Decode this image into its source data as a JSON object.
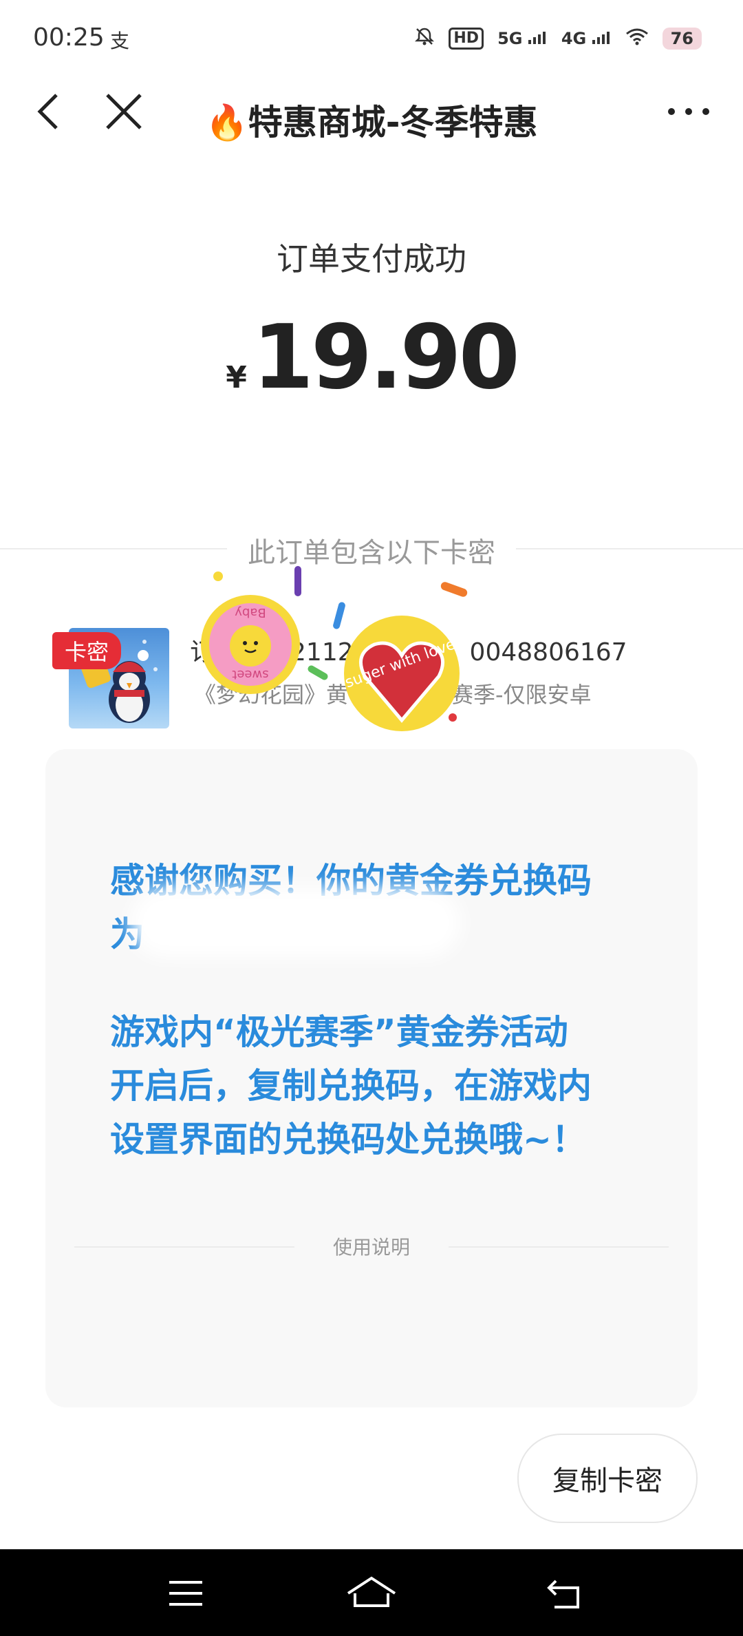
{
  "status_bar": {
    "time": "00:25",
    "app_icon": "支",
    "hd_label": "HD",
    "signal_1": "5G",
    "signal_2": "4G",
    "battery": "76"
  },
  "nav": {
    "title": "🔥特惠商城-冬季特惠",
    "back_icon": "chevron-left-icon",
    "close_icon": "close-icon",
    "more_icon": "more-icon"
  },
  "payment": {
    "status_text": "订单支付成功",
    "currency": "¥",
    "amount": "19.90"
  },
  "divider_text": "此订单包含以下卡密",
  "order": {
    "badge": "卡密",
    "number_prefix": "订",
    "number_visible_1": "21120",
    "number_visible_2": "0048806167",
    "name_1": "《梦幻花园》黄",
    "name_2": "赛季-仅限安卓"
  },
  "card": {
    "line1": "感谢您购买！你的黄金券兑换码",
    "line2": "为",
    "line3": "游戏内“极光赛季”黄金券活动",
    "line4": "开启后，复制兑换码，在游戏内",
    "line5": "设置界面的兑换码处兑换哦~！",
    "usage_label": "使用说明"
  },
  "copy_button": "复制卡密",
  "stickers": {
    "baby_top": "Baby",
    "baby_bottom": "sweet",
    "heart_text": "suger with love"
  },
  "colors": {
    "accent_blue": "#2a8bdc",
    "badge_red": "#e52d36"
  }
}
